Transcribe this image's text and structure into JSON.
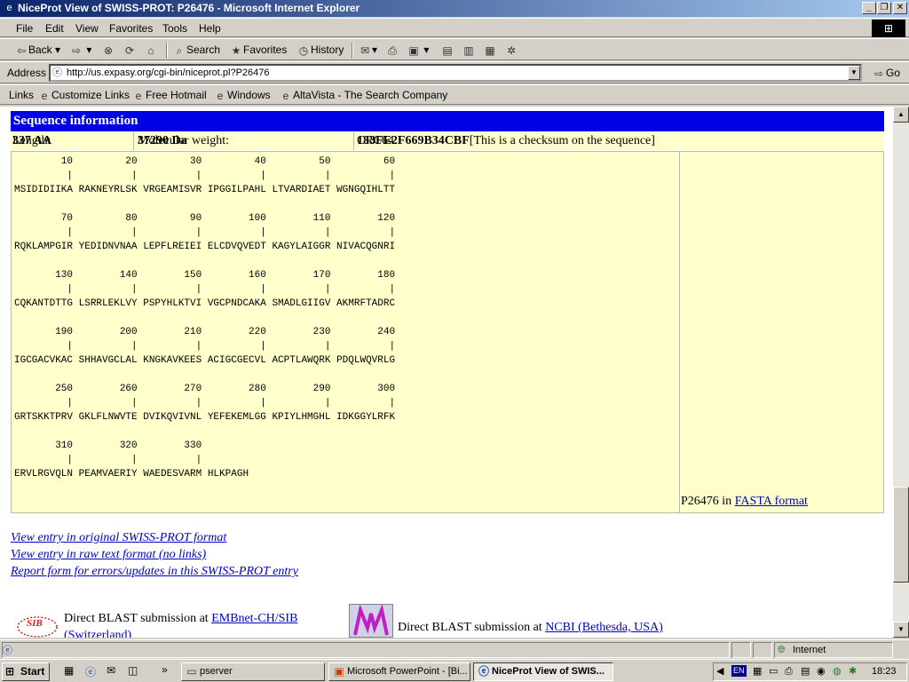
{
  "window": {
    "title": "NiceProt View of SWISS-PROT: P26476 - Microsoft Internet Explorer"
  },
  "menu": [
    "File",
    "Edit",
    "View",
    "Favorites",
    "Tools",
    "Help"
  ],
  "toolbar": {
    "back": "Back",
    "search": "Search",
    "favorites": "Favorites",
    "history": "History"
  },
  "address": {
    "label": "Address",
    "url": "http://us.expasy.org/cgi-bin/niceprot.pl?P26476",
    "go": "Go"
  },
  "links": {
    "label": "Links",
    "items": [
      "Customize Links",
      "Free Hotmail",
      "Windows",
      "AltaVista - The Search Company"
    ]
  },
  "page": {
    "section_title": "Sequence information",
    "length_label": "Length:",
    "length_value": "337 AA",
    "mw_label": "Molecular weight:",
    "mw_value": "37290 Da",
    "crc_label": "CRC64:",
    "crc_value": "183FE2F669B34CBF",
    "crc_note": "[This is a checksum on the sequence]",
    "sequence_blocks": [
      {
        "numbers": "        10         20         30         40         50         60",
        "ticks": "         |          |          |          |          |          |",
        "residues": "MSIDIDIIKA RAKNEYRLSK VRGEAMISVR IPGGILPAHL LTVARDIAET WGNGQIHLTT"
      },
      {
        "numbers": "        70         80         90        100        110        120",
        "ticks": "         |          |          |          |          |          |",
        "residues": "RQKLAMPGIR YEDIDNVNAA LEPFLREIEI ELCDVQVEDT KAGYLAIGGR NIVACQGNRI"
      },
      {
        "numbers": "       130        140        150        160        170        180",
        "ticks": "         |          |          |          |          |          |",
        "residues": "CQKANTDTTG LSRRLEKLVY PSPYHLKTVI VGCPNDCAKA SMADLGIIGV AKMRFTADRC"
      },
      {
        "numbers": "       190        200        210        220        230        240",
        "ticks": "         |          |          |          |          |          |",
        "residues": "IGCGACVKAC SHHAVGCLAL KNGKAVKEES ACIGCGECVL ACPTLAWQRK PDQLWQVRLG"
      },
      {
        "numbers": "       250        260        270        280        290        300",
        "ticks": "         |          |          |          |          |          |",
        "residues": "GRTSKKTPRV GKLFLNWVTE DVIKQVIVNL YEFEKEMLGG KPIYLHMGHL IDKGGYLRFK"
      },
      {
        "numbers": "       310        320        330",
        "ticks": "         |          |          |",
        "residues": "ERVLRGVQLN PEAMVAERIY WAEDESVARM HLKPAGH"
      }
    ],
    "fasta_prefix": "P26476 in",
    "fasta_link": "FASTA format",
    "links": [
      "View entry in original SWISS-PROT format",
      "View entry in raw text format (no links)",
      "Report form for errors/updates in this SWISS-PROT entry"
    ],
    "blast1_prefix": "Direct BLAST submission at",
    "blast1_link": "EMBnet-CH/SIB",
    "blast1_link2": "(Switzerland)",
    "sib_logo": "SIB",
    "blast2_prefix": "Direct BLAST submission at",
    "blast2_link": "NCBI (Bethesda, USA)"
  },
  "status": {
    "zone": "Internet"
  },
  "taskbar": {
    "start": "Start",
    "tasks": [
      "pserver",
      "Microsoft PowerPoint - [Bi...",
      "NiceProt View of SWIS..."
    ],
    "lang": "EN",
    "clock": "18:23"
  }
}
